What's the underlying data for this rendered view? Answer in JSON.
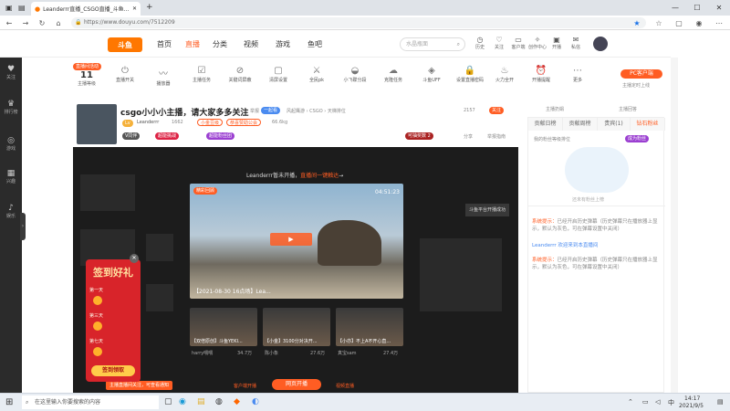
{
  "browser": {
    "tab_title": "Leanderrr直播_CSGO直播_斗鱼直播",
    "url": "https://www.douyu.com/7512209",
    "minimize": "—",
    "maximize": "☐",
    "close": "✕"
  },
  "nav": {
    "logo": "斗鱼",
    "items": [
      "首页",
      "直播",
      "分类",
      "视频",
      "游戏",
      "鱼吧"
    ],
    "search_placeholder": "水晶瓶面",
    "tools": [
      "历史",
      "关注",
      "客户端",
      "创作中心",
      "开播",
      "私信"
    ]
  },
  "sidebar": [
    "关注",
    "排行榜",
    "游戏",
    "兴趣",
    "娱乐"
  ],
  "toolrow": {
    "badge_top": "直播间活动",
    "level": "11",
    "level_label": "主播等级",
    "items": [
      "直播开关",
      "播放器",
      "主播任务",
      "关键词屏蔽",
      "清屏设置",
      "全民pk",
      "小飞碟分段",
      "克隆任务",
      "斗鱼UFF",
      "设置直播密码",
      "火力全开",
      "开播提醒",
      "更多"
    ],
    "pc_button": "PC客户端",
    "pc_sub": "主播定时上线"
  },
  "room": {
    "title": "csgo小小小主播，请大家多多关注",
    "report": "举报",
    "pill_a": "一起看",
    "crumbs": "风起鹰游 › CSGO › 天梯排位",
    "streamer": "Leanderrr",
    "heat": "1662",
    "tag1": "小金豆级",
    "tag2": "恭喜赞助公会",
    "followers": "66.6kg",
    "v_tag": "V同伴",
    "pill_b": "超能挑战",
    "pill_c": "超能粉丝团",
    "share": "分享",
    "report2": "举报指南",
    "count": "2157",
    "follow": "关注",
    "button_banner": "可抽奖数 2"
  },
  "player": {
    "notice_head": "Leanderrr暂未开播，",
    "notice_link": "直播间一键触达",
    "notice_tail": "→",
    "live_tag": "精彩回顾",
    "timer": "04:51:23",
    "caption": "【2021-08-30 16点场】Lea...",
    "overlay_text": "斗鱼平台开播成功",
    "thumbs": [
      {
        "title": "【双倍原创】斗鱼YEKI...",
        "author": "harry喂喂",
        "views": "34.7万"
      },
      {
        "title": "【小金】3100分对决开...",
        "author": "陈小象",
        "views": "27.6万"
      },
      {
        "title": "【小亦】不上A不开心直...",
        "author": "真宝sam",
        "views": "27.4万"
      }
    ],
    "bottom_left": "客户端开播",
    "bottom_center": "网页开播",
    "bottom_right": "视频直播",
    "follow_bar": "主播直播间关注，可查看通知"
  },
  "promo": {
    "title": "签到好礼",
    "days": [
      "第一天",
      "第三天",
      "第七天"
    ],
    "cta": "签到领取"
  },
  "chat": {
    "tabs": [
      "贡献日榜",
      "贡献周榜",
      "贵宾(1)",
      "钻石粉丝"
    ],
    "top_link": "主播扔娟",
    "top_right": "主播回答",
    "rank_label": "我的粉丝等级排位",
    "rank_btn": "成为粉丝",
    "empty": "还未有粉丝上榜",
    "msgs": [
      {
        "tag": "系统提示：",
        "text": "已经开启历史弹幕（历史弹幕只在播放器上显示，默认为灰色，可在弹幕设置中关闭）"
      },
      {
        "tag": "",
        "text": "Leanderrr 欢迎来到本直播间"
      },
      {
        "tag": "系统提示：",
        "text": "已经开启历史弹幕（历史弹幕只在播放器上显示，默认为灰色，可在弹幕设置中关闭）"
      }
    ]
  },
  "taskbar": {
    "search_placeholder": "在这里输入你要搜索的内容",
    "time": "14:17",
    "date": "2021/9/5",
    "ime": "中"
  },
  "colors": {
    "accent": "#ff5d23",
    "dark": "#1c1c1c",
    "sidebar": "#2b2b2b"
  }
}
